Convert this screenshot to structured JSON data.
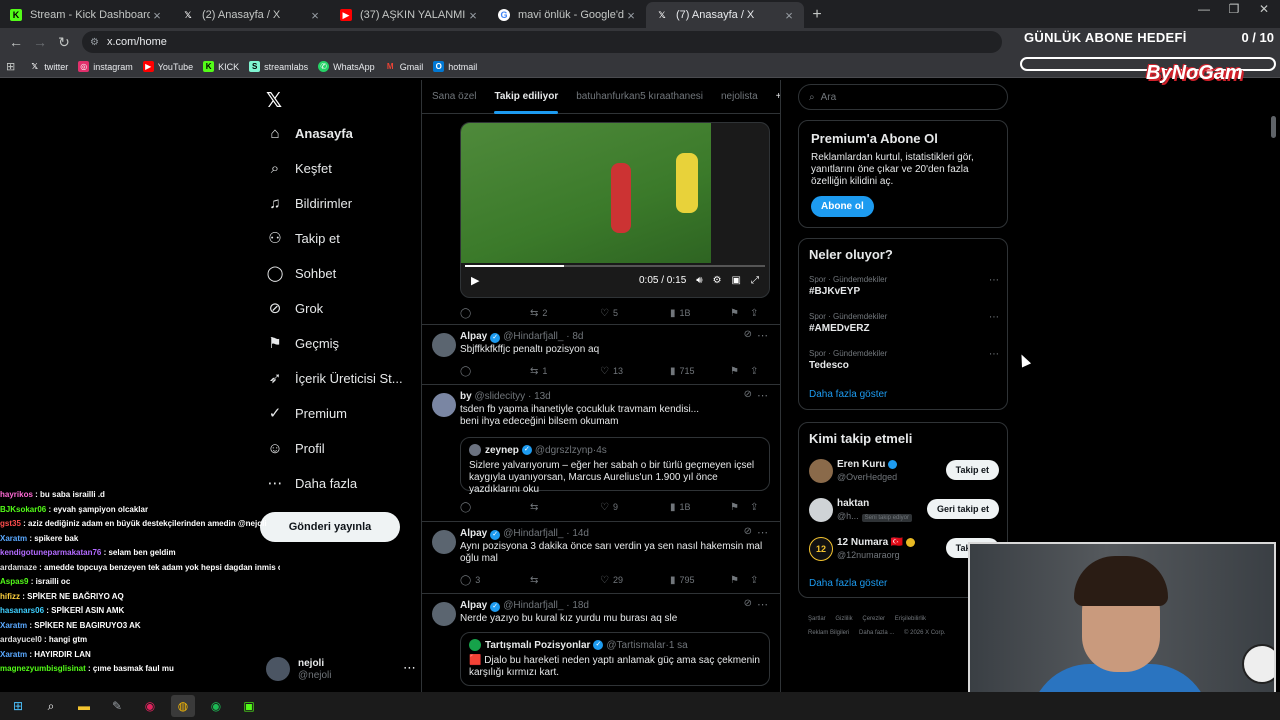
{
  "browser": {
    "tabs": [
      {
        "title": "Stream - Kick Dashboard",
        "icon": "K",
        "color": "#53fc18"
      },
      {
        "title": "(2) Anasayfa / X",
        "icon": "X",
        "color": "#ffffff"
      },
      {
        "title": "(37) AŞKIN YALANMIŞ - You",
        "icon": "▶",
        "color": "#ff0000"
      },
      {
        "title": "mavi önlük - Google'da Ara",
        "icon": "G",
        "color": "#4285f4"
      },
      {
        "title": "(7) Anasayfa / X",
        "icon": "X",
        "color": "#ffffff"
      }
    ],
    "url": "x.com/home",
    "bookmarks": [
      {
        "label": "twitter",
        "icon": "X",
        "color": "#ffffff"
      },
      {
        "label": "instagram",
        "icon": "◎",
        "color": "#e1306c"
      },
      {
        "label": "YouTube",
        "icon": "▶",
        "color": "#ff0000"
      },
      {
        "label": "KICK",
        "icon": "K",
        "color": "#53fc18"
      },
      {
        "label": "streamlabs",
        "icon": "S",
        "color": "#80f5d2"
      },
      {
        "label": "WhatsApp",
        "icon": "✆",
        "color": "#25d366"
      },
      {
        "label": "Gmail",
        "icon": "M",
        "color": "#ea4335"
      },
      {
        "label": "hotmail",
        "icon": "O",
        "color": "#0078d4"
      }
    ]
  },
  "nav": {
    "items": [
      {
        "label": "Anasayfa",
        "icon": "⌂"
      },
      {
        "label": "Keşfet",
        "icon": "⌕"
      },
      {
        "label": "Bildirimler",
        "icon": "🔔"
      },
      {
        "label": "Takip et",
        "icon": "👤"
      },
      {
        "label": "Sohbet",
        "icon": "💬"
      },
      {
        "label": "Grok",
        "icon": "⊘"
      },
      {
        "label": "Geçmiş",
        "icon": "🔖"
      },
      {
        "label": "İçerik Üreticisi St...",
        "icon": "🚀"
      },
      {
        "label": "Premium",
        "icon": "✓"
      },
      {
        "label": "Profil",
        "icon": "👤"
      },
      {
        "label": "Daha fazla",
        "icon": "⋯"
      }
    ],
    "post_button": "Gönderi yayınla",
    "account_name": "nejoli",
    "account_handle": "@nejoli"
  },
  "feed": {
    "tabs": [
      "Sana özel",
      "Takip ediliyor",
      "batuhanfurkan5 kıraathanesi",
      "nejolista"
    ],
    "video": {
      "time": "0:05 / 0:15",
      "progress": 0.33,
      "stats": {
        "reply": "",
        "repost": "2",
        "like": "5",
        "views": "1B"
      }
    },
    "posts": [
      {
        "name": "Alpay",
        "handle": "@Hindarfjall_",
        "time": "8d",
        "text": "Sbjffkkfkffjc penaltı pozisyon aq",
        "stats": {
          "reply": "",
          "repost": "1",
          "like": "13",
          "views": "715"
        }
      },
      {
        "name": "by",
        "handle": "@slidecityy",
        "time": "13d",
        "text": "tsden fb yapma ihanetiyle çocukluk travmam kendisi...\nbeni ihya edeceğini bilsem okumam",
        "quote": {
          "name": "zeynep",
          "handle": "@dgrszlzynp",
          "time": "4s",
          "text": "Sizlere yalvarıyorum – eğer her sabah o bir türlü geçmeyen içsel kaygıyla uyanıyorsan, Marcus Aurelius'un 1.900 yıl önce yazdıklarını oku"
        },
        "stats": {
          "reply": "",
          "repost": "",
          "like": "9",
          "views": "1B"
        }
      },
      {
        "name": "Alpay",
        "handle": "@Hindarfjall_",
        "time": "14d",
        "text": "Aynı pozisyona 3 dakika önce sarı verdin ya sen nasıl hakemsin mal oğlu mal",
        "stats": {
          "reply": "3",
          "repost": "",
          "like": "29",
          "views": "795"
        }
      },
      {
        "name": "Alpay",
        "handle": "@Hindarfjall_",
        "time": "18d",
        "text": "Nerde yazıyo bu kural kız yurdu mu burası aq sle",
        "quote": {
          "name": "Tartışmalı Pozisyonlar",
          "handle": "@Tartismalar",
          "time": "1 sa",
          "text": "🟥 Djalo bu hareketi neden yaptı anlamak güç ama saç çekmenin karşılığı kırmızı kart."
        }
      }
    ]
  },
  "right": {
    "search_placeholder": "Ara",
    "premium": {
      "title": "Premium'a Abone Ol",
      "text": "Reklamlardan kurtul, istatistikleri gör, yanıtlarını öne çıkar ve 20'den fazla özelliğin kilidini aç.",
      "button": "Abone ol"
    },
    "trends": {
      "title": "Neler oluyor?",
      "items": [
        {
          "category": "Spor · Gündemdekiler",
          "name": "#BJKvEYP"
        },
        {
          "category": "Spor · Gündemdekiler",
          "name": "#AMEDvERZ"
        },
        {
          "category": "Spor · Gündemdekiler",
          "name": "Tedesco"
        }
      ],
      "show_more": "Daha fazla göster"
    },
    "who": {
      "title": "Kimi takip etmeli",
      "items": [
        {
          "name": "Eren Kuru",
          "handle": "@OverHedged",
          "button": "Takip et",
          "tag": ""
        },
        {
          "name": "haktan",
          "handle": "@h...",
          "button": "Geri takip et",
          "tag": "Seni takip ediyor"
        },
        {
          "name": "12 Numara 🇹🇷",
          "handle": "@12numaraorg",
          "button": "Takip et",
          "tag": ""
        }
      ],
      "show_more": "Daha fazla göster"
    },
    "footer": [
      "Şartlar",
      "Gizlilik",
      "Çerezler",
      "Erişilebilirlik",
      "Reklam Bilgileri",
      "Daha fazla ...",
      "© 2026 X Corp."
    ]
  },
  "chat": [
    {
      "user": "hayrikos",
      "color": "#ff6ad5",
      "msg": "bu saba israilli .d"
    },
    {
      "user": "BJKsokar06",
      "color": "#53fc18",
      "msg": "eyvah şampiyon olcaklar"
    },
    {
      "user": "gst35",
      "color": "#ff4d4d",
      "msg": "aziz dediğiniz adam en büyük destekçilerinden amedin @nejoli"
    },
    {
      "user": "Xaratm",
      "color": "#5aa9ff",
      "msg": "spikere bak"
    },
    {
      "user": "kendigotuneparmakatan76",
      "color": "#b36bff",
      "msg": "selam ben geldim"
    },
    {
      "user": "ardamaze",
      "color": "#dddddd",
      "msg": "amedde topcuya benzeyen tek adam yok hepsi dagdan inmis orospu evlatlari"
    },
    {
      "user": "Aspas9",
      "color": "#53fc18",
      "msg": "israilli oc"
    },
    {
      "user": "hifizz",
      "color": "#ffd23f",
      "msg": "SPİKER NE BAĞRIYO AQ"
    },
    {
      "user": "hasanars06",
      "color": "#3fd0ff",
      "msg": "SPİKERİ ASIN AMK"
    },
    {
      "user": "Xaratm",
      "color": "#5aa9ff",
      "msg": "SPİKER NE BAGIRUYO3 AK"
    },
    {
      "user": "ardayucel0",
      "color": "#dddddd",
      "msg": "hangi gtm"
    },
    {
      "user": "Xaratm",
      "color": "#5aa9ff",
      "msg": "HAYIRDIR LAN"
    },
    {
      "user": "magnezyumbisglisinat",
      "color": "#53fc18",
      "msg": "çıme basmak faul mu"
    }
  ],
  "overlay": {
    "goal_title": "GÜNLÜK ABONE HEDEFİ",
    "goal_count": "0 / 10",
    "goal_progress": 0,
    "brand": "ByNoGam"
  }
}
